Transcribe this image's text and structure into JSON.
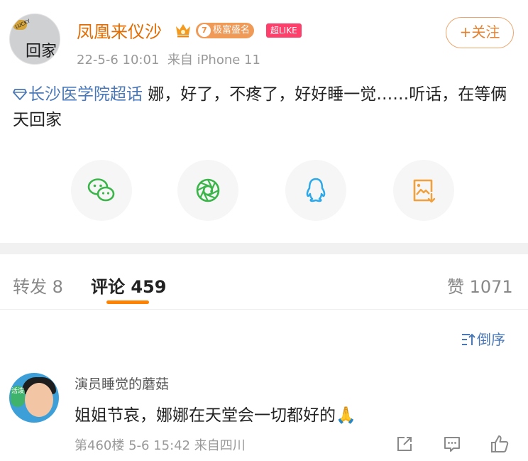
{
  "post": {
    "author": "凤凰来仪沙",
    "level": "7",
    "level_badge": "极富盛名",
    "super_like": "超LIKE",
    "timestamp": "22-5-6 10:01",
    "source": "来自 iPhone 11",
    "follow_label": "+关注",
    "topic": "长沙医学院超话",
    "text": " 娜，好了，不疼了，好好睡一觉……听话，在等俩天回家",
    "avatar_text": "回家",
    "avatar_badge": "LUCKY"
  },
  "share": {
    "items": [
      "wechat-icon",
      "moments-icon",
      "qq-icon",
      "save-image-icon"
    ],
    "colors": {
      "wechat": "#3bb54a",
      "moments": "#3bb54a",
      "qq": "#2da8e8",
      "save": "#f0a03c"
    }
  },
  "tabs": {
    "repost": "转发 8",
    "comments": "评论 459",
    "likes": "赞 1071",
    "active_color": "#ff8200"
  },
  "sort": {
    "label": "倒序"
  },
  "comment": {
    "name": "演员睡觉的蘑菇",
    "text": "姐姐节哀，娜娜在天堂会一切都好的🙏",
    "meta": "第460楼  5-6 15:42  来自四川",
    "avatar_tag": "活泼"
  }
}
